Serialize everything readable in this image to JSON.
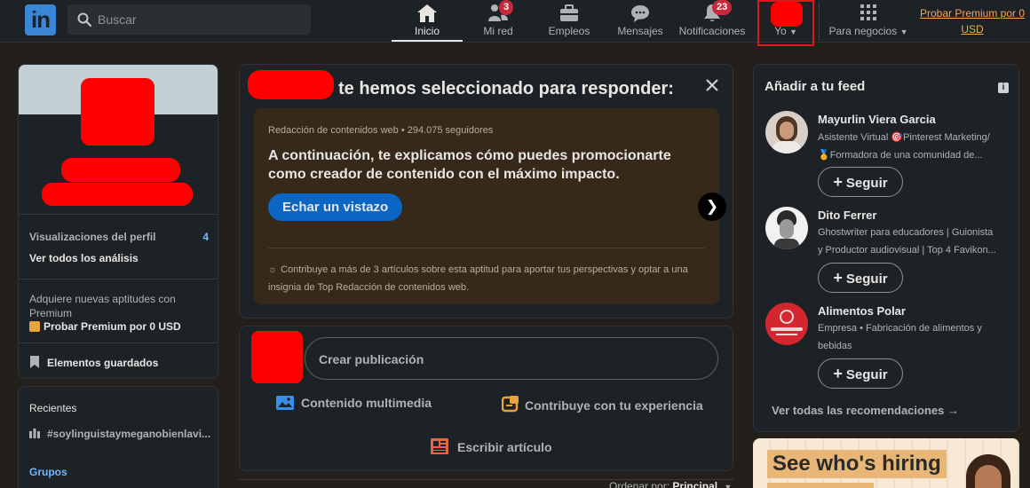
{
  "nav": {
    "logo": "in",
    "search_placeholder": "Buscar",
    "items": [
      {
        "label": "Inicio",
        "icon": "home-icon",
        "badge": ""
      },
      {
        "label": "Mi red",
        "icon": "network-icon",
        "badge": "3"
      },
      {
        "label": "Empleos",
        "icon": "briefcase-icon",
        "badge": ""
      },
      {
        "label": "Mensajes",
        "icon": "messaging-icon",
        "badge": ""
      },
      {
        "label": "Notificaciones",
        "icon": "bell-icon",
        "badge": "23"
      }
    ],
    "me_label": "Yo",
    "business_label": "Para negocios",
    "premium_link": "Probar Premium por 0 USD"
  },
  "left": {
    "profile_views_label": "Visualizaciones del perfil",
    "profile_views_count": "4",
    "analytics_link": "Ver todos los análisis",
    "premium_text": "Adquiere nuevas aptitudes con Premium",
    "premium_cta": "Probar Premium por 0 USD",
    "saved_items": "Elementos guardados",
    "recent_title": "Recientes",
    "recent_item": "#soylinguistaymeganobienlavi...",
    "groups_label": "Grupos"
  },
  "center": {
    "suggestion_title_suffix": "te hemos seleccionado para responder:",
    "skill_meta": "Redacción de contenidos web • 294.075 seguidores",
    "skill_heading": "A continuación, te explicamos cómo puedes promocionarte como creador de contenido con el máximo impacto.",
    "skill_cta": "Echar un vistazo",
    "skill_note": "Contribuye a más de 3 artículos sobre esta aptitud para aportar tus perspectivas y optar a una insignia de Top Redacción de contenidos web.",
    "post_placeholder": "Crear publicación",
    "action_media": "Contenido multimedia",
    "action_contribute": "Contribuye con tu experiencia",
    "action_article": "Escribir artículo",
    "sort_label": "Ordenar por:",
    "sort_value": "Principal"
  },
  "right": {
    "feed_title": "Añadir a tu feed",
    "suggestions": [
      {
        "name": "Mayurlin Viera Garcia",
        "subtitle_1": "Asistente Virtual 🎯Pinterest Marketing/",
        "subtitle_2": "🏅Formadora de una comunidad de...",
        "follow": "Seguir"
      },
      {
        "name": "Dito Ferrer",
        "subtitle_1": "Ghostwriter para educadores | Guionista",
        "subtitle_2": "y Productor audiovisual | Top 4 Favikon...",
        "follow": "Seguir"
      },
      {
        "name": "Alimentos Polar",
        "subtitle_1": "Empresa • Fabricación de alimentos y",
        "subtitle_2": "bebidas",
        "follow": "Seguir"
      }
    ],
    "see_all": "Ver todas las recomendaciones →",
    "ad_text": "See who's hiring",
    "colors": {
      "accent": "#71b7fb",
      "premium": "#f0a85a",
      "badge": "#c9273a",
      "cta": "#0a66c2"
    }
  }
}
